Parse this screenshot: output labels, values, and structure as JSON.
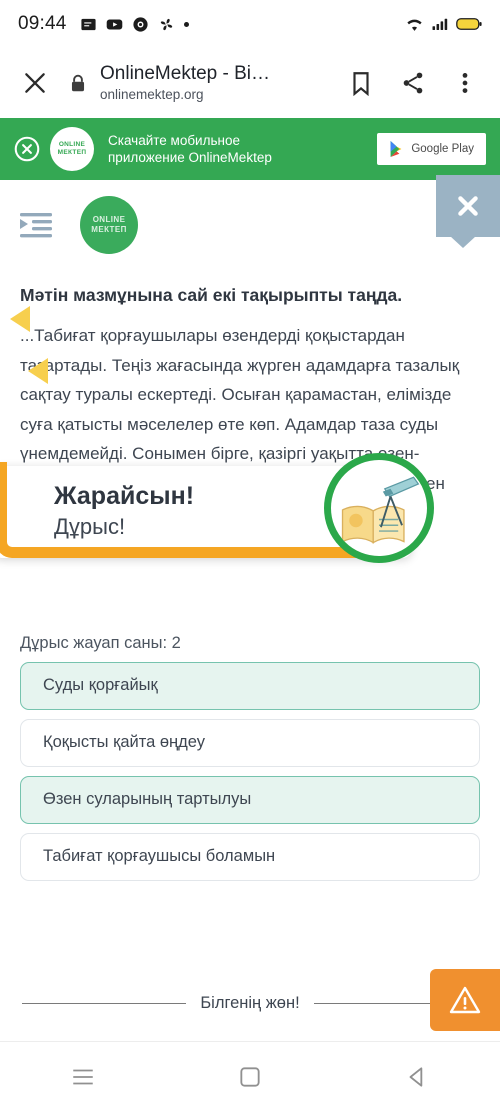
{
  "statusbar": {
    "time": "09:44",
    "notification_icons": [
      "messages-icon",
      "youtube-icon",
      "chrome-icon",
      "pinwheel-icon",
      "more-dot-icon"
    ],
    "right_icons": [
      "wifi-icon",
      "signal-icon",
      "battery-icon"
    ],
    "battery_color": "#f5d43c"
  },
  "browser": {
    "close_label": "close-icon",
    "title": "OnlineMektep - Bi…",
    "url": "onlinemektep.org",
    "actions": [
      "bookmark-icon",
      "share-icon",
      "overflow-menu-icon"
    ]
  },
  "app_banner": {
    "background": "#34a853",
    "logo_line1": "ONLINE",
    "logo_line2": "МЕКТЕП",
    "text_line1": "Скачайте мобильное",
    "text_line2": "приложение OnlineMektep",
    "store_button": "Google Play"
  },
  "sitenav": {
    "indent_icon": "indent-menu-icon",
    "logo_line1": "ONLINE",
    "logo_line2": "МЕКТЕП",
    "list_icon": "list-view-icon",
    "tooltip_close_icon": "close-icon"
  },
  "lesson": {
    "question_title": "Мәтін мазмұнына сай екі тақырыпты таңда.",
    "body_text": "...Табиғат қорғаушылары өзендерді қоқыстардан тазартады. Теңіз жағасында жүрген адамдарға тазалық сақтау туралы ескертеді. Осыған қарамастан, елімізде суға қатысты мәселелер өте көп. Адамдар таза суды үнемдемейді. Сонымен бірге, қазіргі уақытта өзен-көлдердің арналары тартылып жатыр. Оның көптеген себептері бар. Кейбір өзен аст..."
  },
  "popup": {
    "title": "Жарайсын!",
    "subtitle": "Дұрыс!",
    "badge_icon": "book-telescope-icon",
    "accent_color": "#f5a623",
    "ring_color": "#2ba84a"
  },
  "answers": {
    "count_label": "Дұрыс жауап саны: 2",
    "options": [
      {
        "label": "Суды қорғайық",
        "selected": true
      },
      {
        "label": "Қоқысты қайта өңдеу",
        "selected": false
      },
      {
        "label": "Өзен суларының тартылуы",
        "selected": true
      },
      {
        "label": "Табиғат қорғаушысы боламын",
        "selected": false
      }
    ]
  },
  "footer": {
    "divider_label": "Білгенің жөн!",
    "warning_icon": "warning-triangle-icon",
    "warning_color": "#f0902f"
  },
  "androidnav": {
    "icons": [
      "recents-icon",
      "home-icon",
      "back-icon"
    ]
  }
}
